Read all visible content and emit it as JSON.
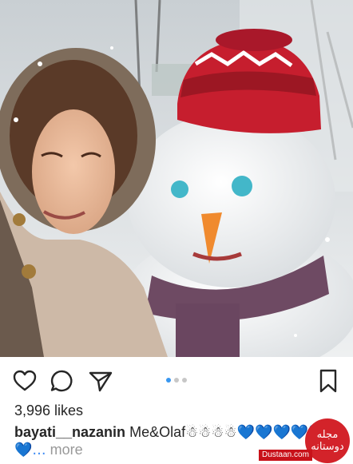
{
  "post": {
    "image_alt": "Selfie with a snowman wearing a red knit hat",
    "carousel": {
      "total": 3,
      "active": 1
    },
    "likes": "3,996 likes",
    "caption": {
      "username": "bayati__nazanin",
      "text": "Me&Olaf",
      "snowmen": "☃☃☃☃",
      "hearts": "💙💙💙💙💙",
      "ellipsis": "💙...",
      "more": "more"
    }
  },
  "actions": {
    "like": "heart-icon",
    "comment": "comment-icon",
    "share": "send-icon",
    "save": "bookmark-icon"
  },
  "watermark": {
    "brand": "مجله دوستانه",
    "url": "Dustaan.com"
  },
  "colors": {
    "accent": "#3897f0",
    "badge": "#d3232a",
    "heart_emoji": "#3d8bf5"
  }
}
